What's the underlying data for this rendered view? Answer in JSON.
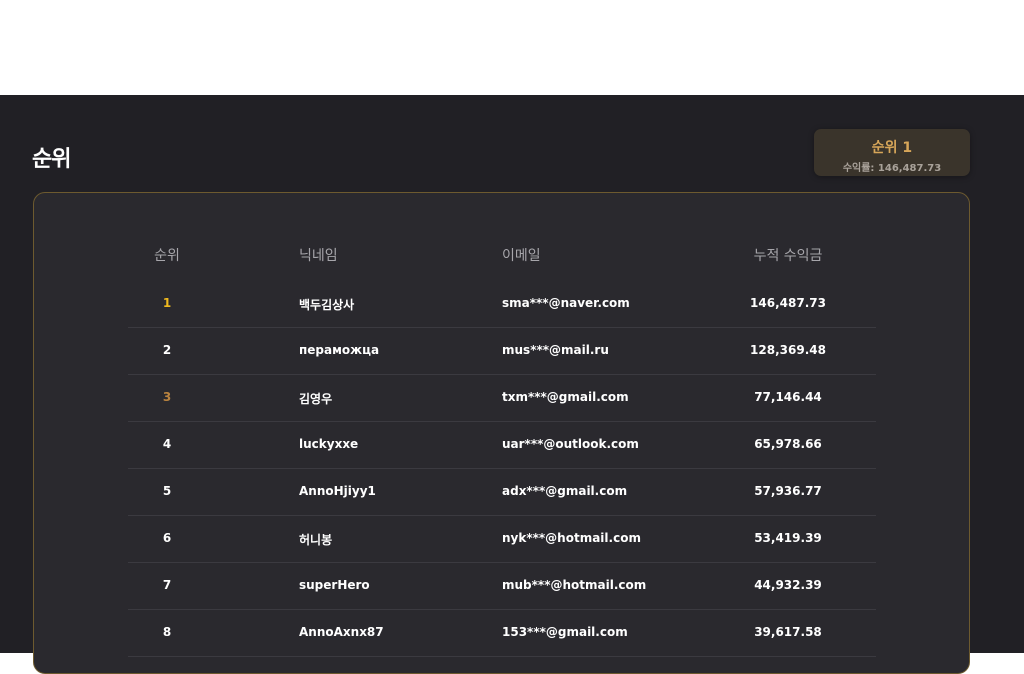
{
  "page": {
    "title": "순위"
  },
  "badge": {
    "title": "순위 1",
    "subtitle": "수익률: 146,487.73"
  },
  "table": {
    "headers": [
      "순위",
      "닉네임",
      "이메일",
      "누적 수익금"
    ],
    "rows": [
      {
        "rank": "1",
        "nickname": "백두김상사",
        "email": "sma***@naver.com",
        "total": "146,487.73"
      },
      {
        "rank": "2",
        "nickname": "пераможца",
        "email": "mus***@mail.ru",
        "total": "128,369.48"
      },
      {
        "rank": "3",
        "nickname": "김영우",
        "email": "txm***@gmail.com",
        "total": "77,146.44"
      },
      {
        "rank": "4",
        "nickname": "luckyxxe",
        "email": "uar***@outlook.com",
        "total": "65,978.66"
      },
      {
        "rank": "5",
        "nickname": "AnnoHjiyy1",
        "email": "adx***@gmail.com",
        "total": "57,936.77"
      },
      {
        "rank": "6",
        "nickname": "허니봉",
        "email": "nyk***@hotmail.com",
        "total": "53,419.39"
      },
      {
        "rank": "7",
        "nickname": "superHero",
        "email": "mub***@hotmail.com",
        "total": "44,932.39"
      },
      {
        "rank": "8",
        "nickname": "AnnoAxnx87",
        "email": "153***@gmail.com",
        "total": "39,617.58"
      }
    ]
  },
  "colors": {
    "background": "#212025",
    "card": "#2a292e",
    "gold": "#efb91f",
    "bronze": "#b9833f",
    "accent": "#d7a659"
  }
}
